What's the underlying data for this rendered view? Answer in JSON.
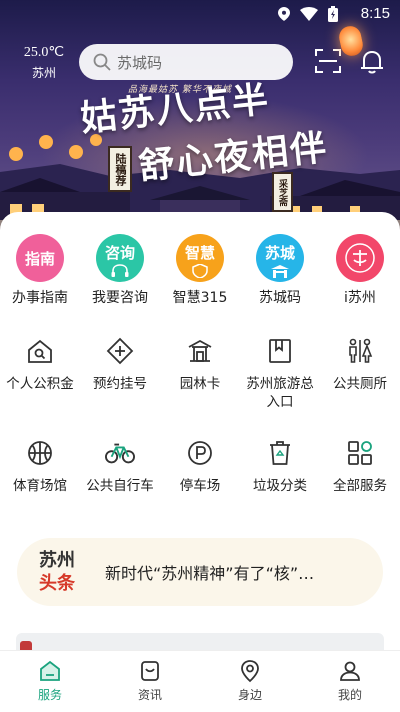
{
  "status_bar": {
    "time": "8:15",
    "icons": [
      "location-icon",
      "wifi-icon",
      "battery-icon"
    ]
  },
  "header": {
    "temperature": "25.0℃",
    "city": "苏州",
    "search_placeholder": "苏城码",
    "scan_icon": "scan-icon",
    "notification_icon": "bell-icon"
  },
  "banner": {
    "tagline": "品海最姑苏  繁华不夜城",
    "line1": "姑苏八点半",
    "line2": "舒心夜相伴",
    "sign_left": "陆稿荐",
    "sign_right": "采芝斋"
  },
  "featured_services": [
    {
      "label": "办事指南",
      "badge": "指南",
      "color": "#f0609a"
    },
    {
      "label": "我要咨询",
      "badge": "咨询",
      "color": "#2bc6a6"
    },
    {
      "label": "智慧315",
      "badge": "智慧",
      "color": "#f7a21b"
    },
    {
      "label": "苏城码",
      "badge": "苏城",
      "color": "#26b5e8"
    },
    {
      "label": "i苏州",
      "badge": "i",
      "color": "#f2476a"
    }
  ],
  "services_row2": [
    {
      "label": "个人公积金",
      "icon": "house-icon"
    },
    {
      "label": "预约挂号",
      "icon": "medical-cross-icon"
    },
    {
      "label": "园林卡",
      "icon": "pavilion-icon"
    },
    {
      "label": "苏州旅游总入口",
      "icon": "bookmark-icon"
    },
    {
      "label": "公共厕所",
      "icon": "restroom-icon"
    }
  ],
  "services_row3": [
    {
      "label": "体育场馆",
      "icon": "basketball-icon"
    },
    {
      "label": "公共自行车",
      "icon": "bicycle-icon"
    },
    {
      "label": "停车场",
      "icon": "parking-icon"
    },
    {
      "label": "垃圾分类",
      "icon": "trash-icon"
    },
    {
      "label": "全部服务",
      "icon": "grid-icon"
    }
  ],
  "news": {
    "brand_line1": "苏州",
    "brand_line2": "头条",
    "headline": "新时代“苏州精神”有了“核”…"
  },
  "tabs": [
    {
      "label": "服务",
      "icon": "home-icon",
      "active": true
    },
    {
      "label": "资讯",
      "icon": "news-icon",
      "active": false
    },
    {
      "label": "身边",
      "icon": "location-pin-icon",
      "active": false
    },
    {
      "label": "我的",
      "icon": "profile-icon",
      "active": false
    }
  ],
  "colors": {
    "accent": "#1aa37e",
    "news_red": "#d63a2a",
    "icon_stroke": "#333333"
  }
}
